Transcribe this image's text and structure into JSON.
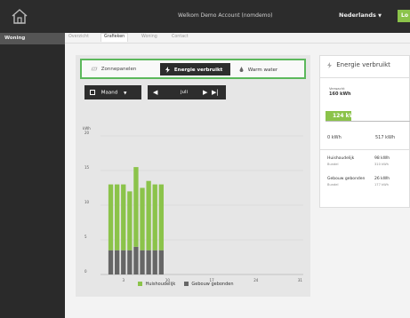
{
  "header": {
    "title": "Welkom Demo Account (nomdemo)",
    "language": "Nederlands",
    "logout_partial": "Lo"
  },
  "sidebar": {
    "items": [
      {
        "label": "Woning"
      }
    ]
  },
  "tabs": [
    {
      "label": "Overzicht",
      "active": false
    },
    {
      "label": "Grafieken",
      "active": true
    },
    {
      "label": "Woning",
      "active": false
    },
    {
      "label": "Contact",
      "active": false
    }
  ],
  "selector": {
    "zonnepanelen": "Zonnepanelen",
    "energie": "Energie verbruikt",
    "warm_water": "Warm water",
    "selected": "Energie verbruikt"
  },
  "controls": {
    "period": "Maand",
    "month": "juli"
  },
  "chart_data": {
    "type": "bar",
    "stacked": true,
    "ylabel": "kWh",
    "ylim": [
      0,
      20
    ],
    "yticks": [
      0,
      5,
      10,
      15,
      20
    ],
    "xticks": [
      3,
      10,
      17,
      24,
      31
    ],
    "xlim": [
      0.5,
      31.5
    ],
    "categories": [
      1,
      2,
      3,
      4,
      5,
      6,
      7,
      8,
      9
    ],
    "series": [
      {
        "name": "Huishoudelijk",
        "color": "#8bc34a",
        "values": [
          9.5,
          9.5,
          9.5,
          8.5,
          11.5,
          9,
          10,
          9.5,
          9.5
        ]
      },
      {
        "name": "Gebouw gebonden",
        "color": "#666666",
        "values": [
          3.5,
          3.5,
          3.5,
          3.5,
          4,
          3.5,
          3.5,
          3.5,
          3.5
        ]
      }
    ],
    "grid": true,
    "legend_position": "bottom"
  },
  "summary": {
    "title": "Energie verbruikt",
    "verwacht_label": "Verwacht",
    "verwacht_value": "160 kWh",
    "current": "124 kWh",
    "current_value": 124,
    "max_value": 517,
    "min_label": "0 kWh",
    "max_label": "517 kWh",
    "rows": [
      {
        "label": "Huishoudelijk",
        "value": "98 kWh",
        "sub": "Bundel",
        "subvalue": "310 kWh"
      },
      {
        "label": "Gebouw gebonden",
        "value": "26 kWh",
        "sub": "Bundel",
        "subvalue": "177 kWh"
      }
    ]
  },
  "colors": {
    "accent": "#8bc34a",
    "dark": "#2d2d2d",
    "border_accent": "#5cb85c"
  }
}
